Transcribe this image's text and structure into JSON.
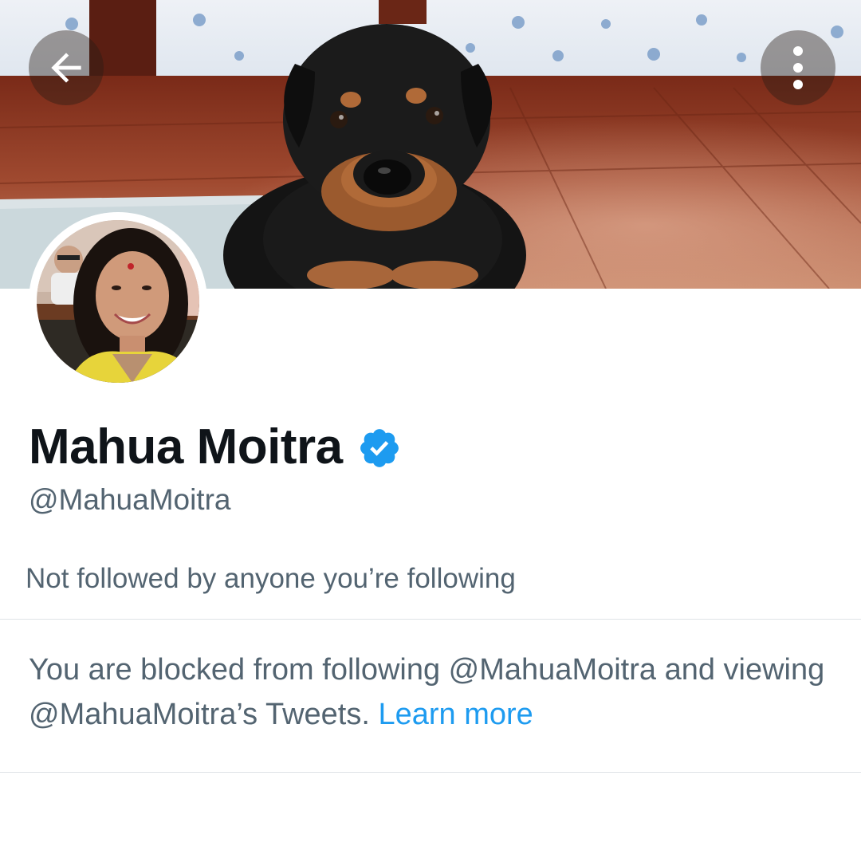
{
  "header": {
    "back_icon": "arrow-left-icon",
    "more_icon": "vertical-ellipsis-icon",
    "banner_image": "rottweiler-puppy-on-wooden-floor"
  },
  "profile": {
    "display_name": "Mahua Moitra",
    "verified_icon": "verified-badge-icon",
    "verified_color": "#1d9bf0",
    "handle": "@MahuaMoitra",
    "avatar_image": "profile-photo"
  },
  "social_context": {
    "text": "Not followed by anyone you’re following"
  },
  "blocked_notice": {
    "message": "You are blocked from following @MahuaMoitra and viewing @MahuaMoitra’s Tweets.",
    "link_label": "Learn more",
    "link_color": "#1d9bf0"
  }
}
